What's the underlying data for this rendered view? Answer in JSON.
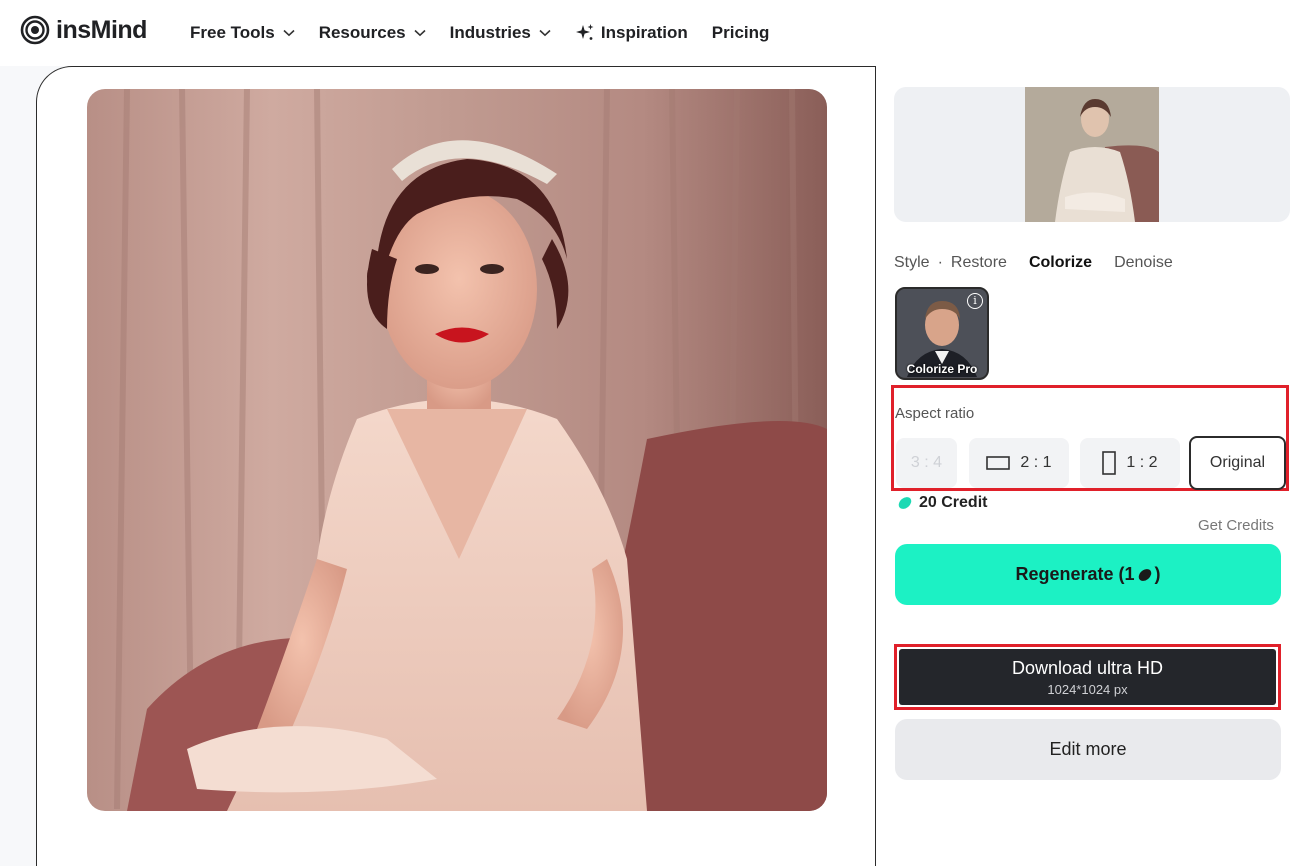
{
  "header": {
    "logo_text": "insMind",
    "nav": [
      {
        "label": "Free Tools",
        "has_dropdown": true
      },
      {
        "label": "Resources",
        "has_dropdown": true
      },
      {
        "label": "Industries",
        "has_dropdown": true
      },
      {
        "label": "Inspiration",
        "icon": "sparkle-icon"
      },
      {
        "label": "Pricing"
      }
    ]
  },
  "sidebar": {
    "tabs": [
      "Style",
      "Restore",
      "Colorize",
      "Denoise"
    ],
    "tab_separator": "·",
    "active_tab": "Colorize",
    "model": {
      "label": "Colorize Pro",
      "info_icon": "i"
    },
    "aspect_ratio": {
      "label": "Aspect ratio",
      "options": [
        "3 : 4",
        "2 : 1",
        "1 : 2",
        "Original"
      ],
      "selected": "Original"
    },
    "credits": {
      "amount": "20 Credit",
      "get_label": "Get Credits"
    },
    "regenerate_label": "Regenerate (1",
    "regenerate_suffix": ")",
    "download": {
      "label": "Download ultra HD",
      "size": "1024*1024 px"
    },
    "edit_more_label": "Edit more"
  },
  "colors": {
    "accent": "#1cf1c4",
    "dark_button": "#24262b",
    "highlight_border": "#e0202a"
  }
}
